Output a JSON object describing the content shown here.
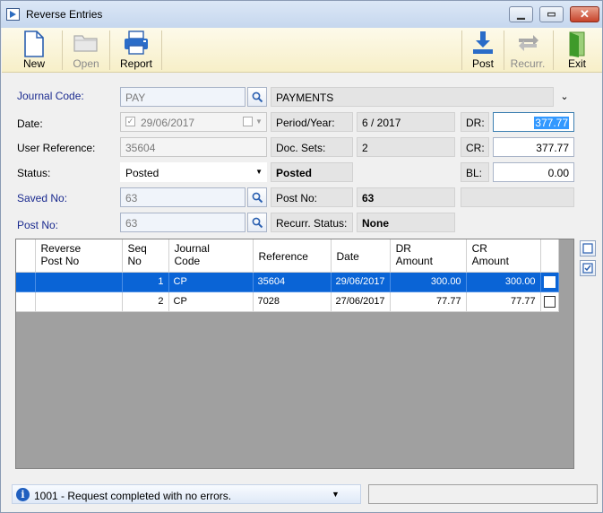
{
  "window": {
    "title": "Reverse Entries"
  },
  "toolbar": {
    "new": "New",
    "open": "Open",
    "report": "Report",
    "post": "Post",
    "recurr": "Recurr.",
    "exit": "Exit"
  },
  "form": {
    "journal_code_label": "Journal Code:",
    "journal_code": "PAY",
    "journal_name": "PAYMENTS",
    "date_label": "Date:",
    "date": "29/06/2017",
    "period_label": "Period/Year:",
    "period": "6 / 2017",
    "dr_label": "DR:",
    "dr": "377.77",
    "user_ref_label": "User Reference:",
    "user_ref": "35604",
    "doc_sets_label": "Doc. Sets:",
    "doc_sets": "2",
    "cr_label": "CR:",
    "cr": "377.77",
    "status_label": "Status:",
    "status": "Posted",
    "status_badge": "Posted",
    "bl_label": "BL:",
    "bl": "0.00",
    "saved_no_label": "Saved No:",
    "saved_no": "63",
    "post_no_label": "Post No:",
    "post_no_value": "63",
    "post_no_field_label": "Post No:",
    "post_no": "63",
    "recurr_status_label": "Recurr. Status:",
    "recurr_status": "None"
  },
  "grid": {
    "headers": {
      "reverse_post_no_1": "Reverse",
      "reverse_post_no_2": "Post No",
      "seq_no_1": "Seq",
      "seq_no_2": "No",
      "journal_code_1": "Journal",
      "journal_code_2": "Code",
      "reference": "Reference",
      "date": "Date",
      "dr_amount_1": "DR",
      "dr_amount_2": "Amount",
      "cr_amount_1": "CR",
      "cr_amount_2": "Amount"
    },
    "rows": [
      {
        "reverse_post_no": "",
        "seq": "1",
        "journal_code": "CP",
        "reference": "35604",
        "date": "29/06/2017",
        "dr": "300.00",
        "cr": "300.00"
      },
      {
        "reverse_post_no": "",
        "seq": "2",
        "journal_code": "CP",
        "reference": "7028",
        "date": "27/06/2017",
        "dr": "77.77",
        "cr": "77.77"
      }
    ]
  },
  "statusbar": {
    "message": "1001 -  Request completed with no errors."
  }
}
